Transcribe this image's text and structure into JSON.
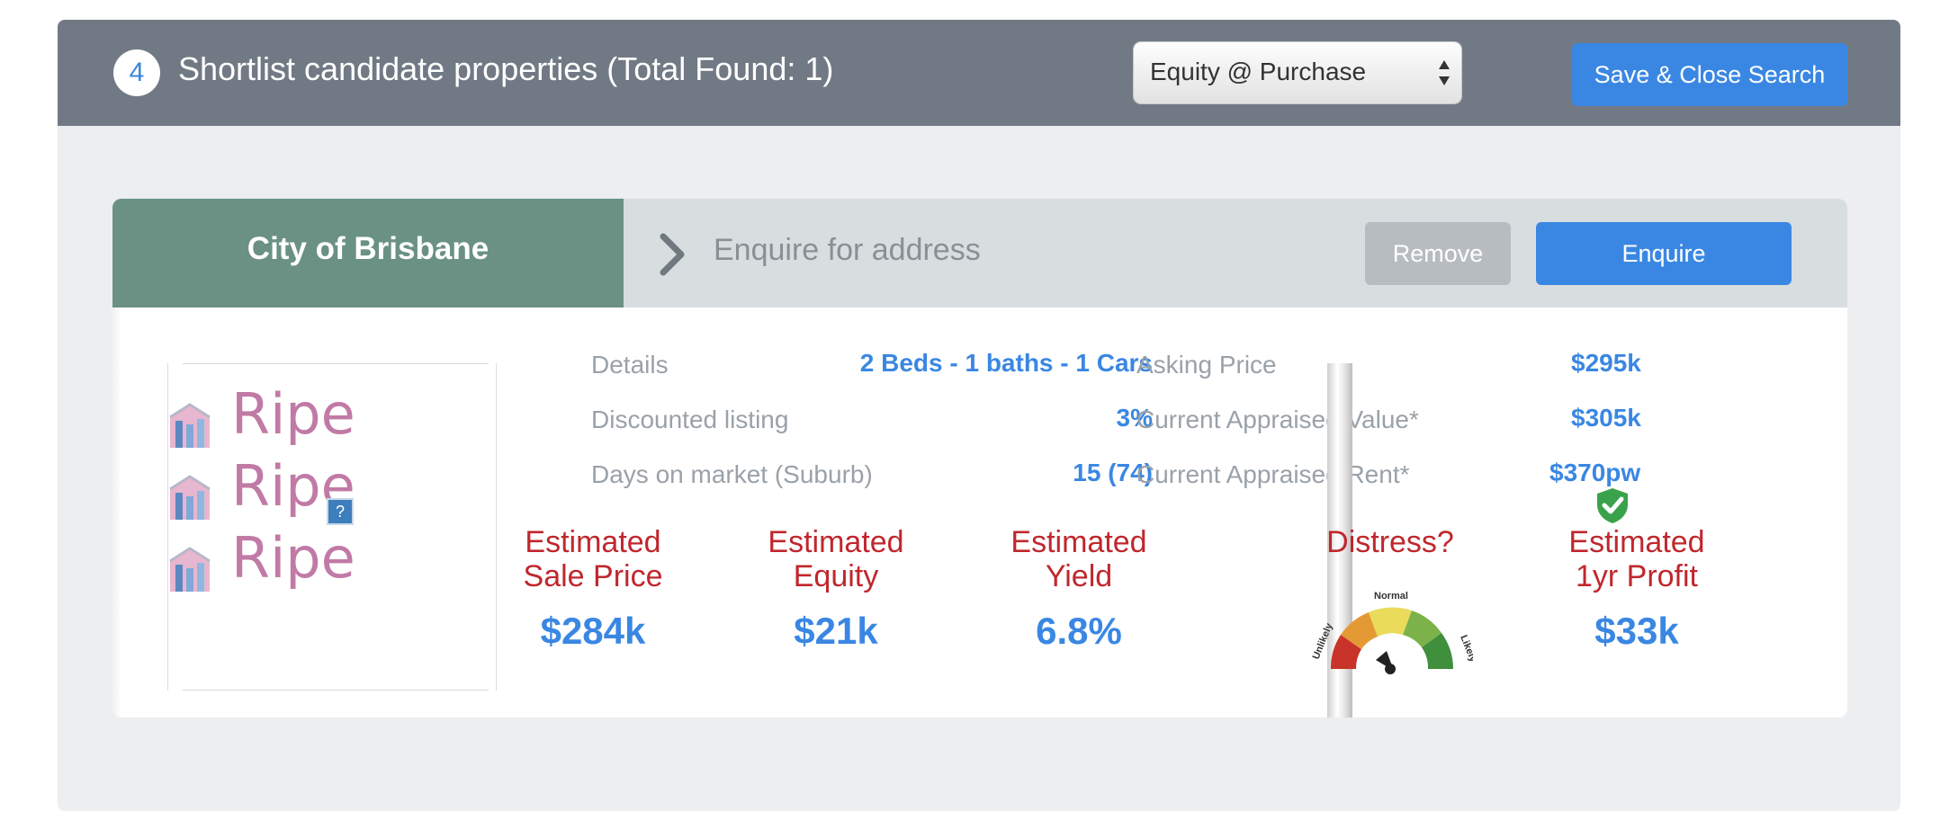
{
  "header": {
    "step_number": "4",
    "title": "Shortlist candidate properties (Total Found: 1)",
    "sort_select_value": "Equity @ Purchase",
    "save_close_label": "Save & Close Search"
  },
  "property": {
    "suburb": "City of Brisbane",
    "address_prompt": "Enquire for address",
    "remove_label": "Remove",
    "enquire_label": "Enquire",
    "logo_text": "Ripe",
    "image_placeholder": "?",
    "details": [
      {
        "label": "Details",
        "value": "2 Beds - 1 baths - 1 Cars"
      },
      {
        "label": "Discounted listing",
        "value": "3%"
      },
      {
        "label": "Days on market (Suburb)",
        "value": "15 (74)"
      }
    ],
    "pricing": [
      {
        "label": "Asking Price",
        "value": "$295k"
      },
      {
        "label": "Current Appraised Value*",
        "value": "$305k",
        "verified": true
      },
      {
        "label": "Current Appraised Rent*",
        "value": "$370pw"
      }
    ],
    "metrics": [
      {
        "label_line1": "Estimated",
        "label_line2": "Sale Price",
        "value": "$284k"
      },
      {
        "label_line1": "Estimated",
        "label_line2": "Equity",
        "value": "$21k"
      },
      {
        "label_line1": "Estimated",
        "label_line2": "Yield",
        "value": "6.8%"
      },
      {
        "label_line1": "Distress?",
        "label_line2": "",
        "value": ""
      },
      {
        "label_line1": "Estimated",
        "label_line2": "1yr Profit",
        "value": "$33k"
      }
    ],
    "distress_gauge": {
      "labels": [
        "Unlikely",
        "Normal",
        "Likely"
      ],
      "colors": [
        "#c8342a",
        "#e49a34",
        "#eadb5a",
        "#7bb24a",
        "#3f8f3c"
      ]
    }
  },
  "colors": {
    "header_bg": "#717a84",
    "accent_blue": "#3a87e3",
    "suburb_green": "#6a9184",
    "metric_red": "#c0272d"
  }
}
